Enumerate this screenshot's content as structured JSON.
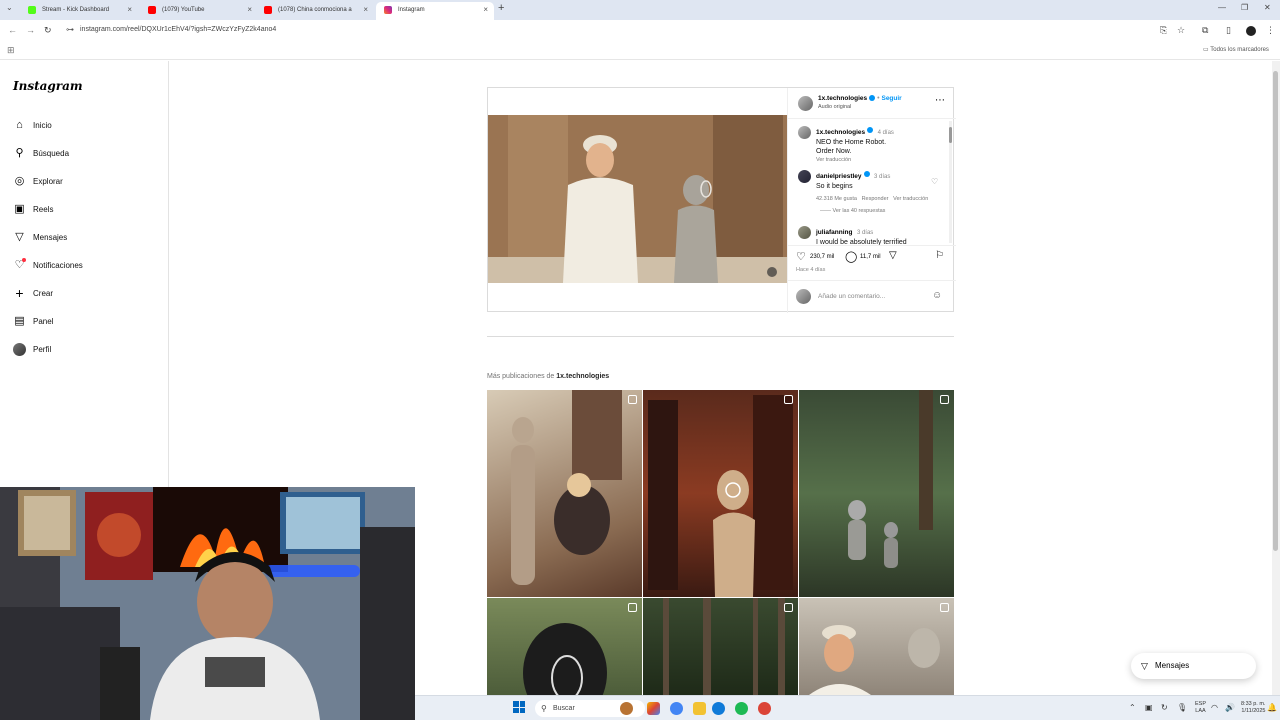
{
  "browser": {
    "tabs": [
      {
        "label": "Stream - Kick Dashboard",
        "favicon_color": "#53fc18"
      },
      {
        "label": "(1079) YouTube",
        "favicon_color": "#ff0000"
      },
      {
        "label": "(1078) China conmociona a",
        "favicon_color": "#ff0000"
      },
      {
        "label": "Instagram",
        "favicon_color": "#e1306c"
      }
    ],
    "url": "instagram.com/reel/DQXUr1cEhV4/?igsh=ZWczYzFyZ2k4ano4",
    "bookmarks_all": "Todos los marcadores"
  },
  "sidebar": {
    "logo": "Instagram",
    "items": [
      {
        "label": "Inicio",
        "icon": "home-icon",
        "glyph": "⌂"
      },
      {
        "label": "Búsqueda",
        "icon": "search-icon",
        "glyph": "⚲"
      },
      {
        "label": "Explorar",
        "icon": "compass-icon",
        "glyph": "◎"
      },
      {
        "label": "Reels",
        "icon": "reels-icon",
        "glyph": "▣"
      },
      {
        "label": "Mensajes",
        "icon": "messenger-icon",
        "glyph": "▽"
      },
      {
        "label": "Notificaciones",
        "icon": "heart-icon",
        "glyph": "♡"
      },
      {
        "label": "Crear",
        "icon": "plus-icon",
        "glyph": "+"
      },
      {
        "label": "Panel",
        "icon": "dashboard-icon",
        "glyph": "▤"
      },
      {
        "label": "Perfil",
        "icon": "profile-avatar-icon",
        "glyph": ""
      }
    ]
  },
  "post": {
    "username": "1x.technologies",
    "follow": "Seguir",
    "audio": "Audio original",
    "caption_user": "1x.technologies",
    "caption_time": "4 días",
    "caption_lines": [
      "NEO the Home Robot.",
      "Order Now."
    ],
    "caption_translate": "Ver traducción",
    "comments": [
      {
        "user": "danielpriestley",
        "time": "3 días",
        "text": "So it begins",
        "likes": "42.318 Me gusta",
        "reply": "Responder",
        "translate": "Ver traducción",
        "view_replies": "Ver las 40 respuestas"
      },
      {
        "user": "juliafanning",
        "time": "3 días",
        "text": "I would be absolutely terrified"
      }
    ],
    "likes_count": "230,7 mil",
    "comments_count": "11,7 mil",
    "posted": "Hace 4 días",
    "add_comment_placeholder": "Añade un comentario..."
  },
  "more_posts": {
    "prefix": "Más publicaciones de ",
    "account": "1x.technologies"
  },
  "floating_messages": "Mensajes",
  "taskbar": {
    "search": "Buscar",
    "lang_line1": "ESP",
    "lang_line2": "LAA",
    "time": "8:33 p. m.",
    "date": "1/11/2025"
  }
}
